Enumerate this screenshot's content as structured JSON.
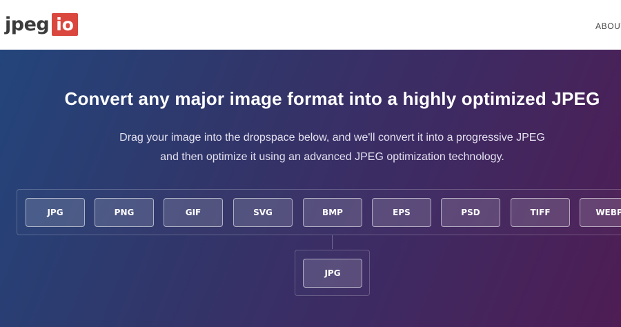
{
  "header": {
    "logo_text": "jpeg",
    "logo_badge": "io",
    "nav_about": "ABOUT"
  },
  "hero": {
    "title": "Convert any major image format into a highly optimized JPEG",
    "subtitle_line1": "Drag your image into the dropspace below, and we'll convert it into a progressive JPEG",
    "subtitle_line2": "and then optimize it using an advanced JPEG optimization technology."
  },
  "formats": [
    "JPG",
    "PNG",
    "GIF",
    "SVG",
    "BMP",
    "EPS",
    "PSD",
    "TIFF",
    "WEBP"
  ],
  "output_format": "JPG",
  "colors": {
    "logo_badge": "#d9473f",
    "gradient_start": "#23457b",
    "gradient_end": "#4e1d54"
  }
}
